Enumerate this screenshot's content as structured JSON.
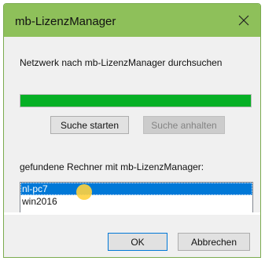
{
  "window": {
    "title": "mb-LizenzManager"
  },
  "search": {
    "label": "Netzwerk nach mb-LizenzManager durchsuchen",
    "progress_percent": 100,
    "start_label": "Suche starten",
    "stop_label": "Suche anhalten"
  },
  "found": {
    "label": "gefundene Rechner mit mb-LizenzManager:",
    "items": [
      "nl-pc7",
      "win2016"
    ],
    "selected_index": 0
  },
  "footer": {
    "ok_label": "OK",
    "cancel_label": "Abbrechen"
  },
  "colors": {
    "titlebar": "#8ec05a",
    "progress": "#06b025",
    "selection": "#0078d7"
  },
  "icons": {
    "close": "close-icon"
  }
}
